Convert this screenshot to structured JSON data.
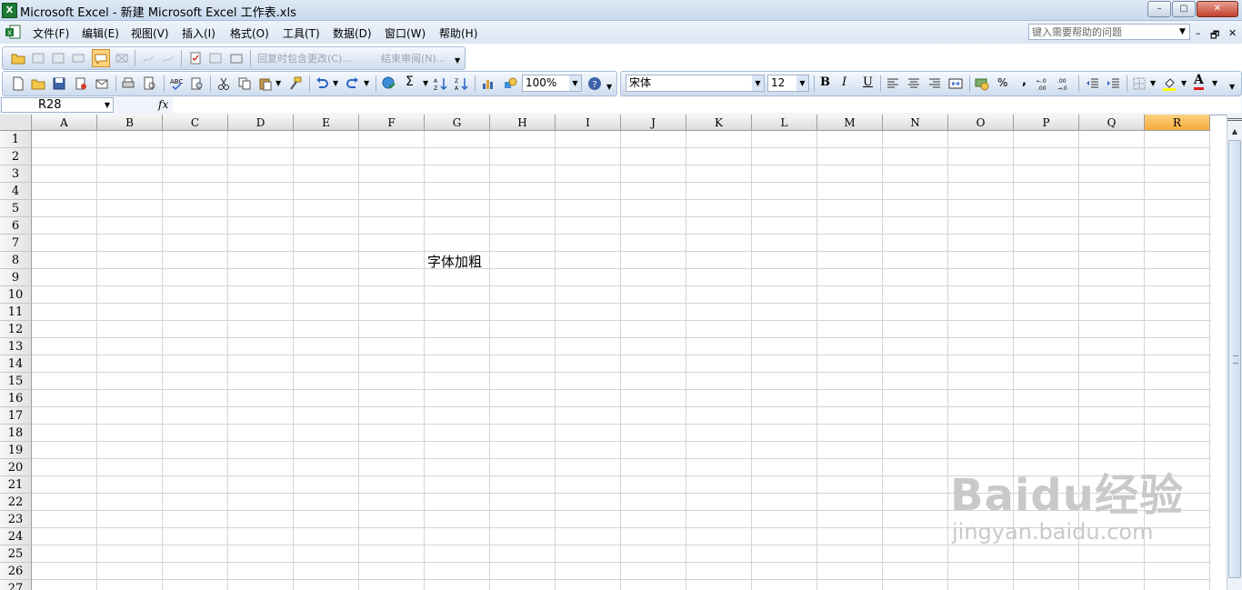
{
  "window": {
    "title": "Microsoft Excel - 新建 Microsoft Excel 工作表.xls",
    "app_icon": "X",
    "controls": {
      "minimize": "–",
      "maximize": "▢",
      "close": "✕"
    }
  },
  "menu": {
    "items": [
      "文件(F)",
      "编辑(E)",
      "视图(V)",
      "插入(I)",
      "格式(O)",
      "工具(T)",
      "数据(D)",
      "窗口(W)",
      "帮助(H)"
    ],
    "help_placeholder": "键入需要帮助的问题",
    "workbook_controls": {
      "minimize": "–",
      "restore": "🗗",
      "close": "✕"
    }
  },
  "review_toolbar": {
    "reply_label": "回复时包含更改(C)...",
    "end_review_label": "结束审阅(N)..."
  },
  "standard_toolbar": {
    "zoom": "100%",
    "sum_symbol": "Σ"
  },
  "formatting_toolbar": {
    "font": "宋体",
    "font_size": "12",
    "bold": "B",
    "italic": "I",
    "underline": "U",
    "percent": "%",
    "comma": ",",
    "font_color_letter": "A"
  },
  "formula_bar": {
    "name_box": "R28",
    "fx": "fx",
    "formula": ""
  },
  "sheet": {
    "columns": [
      "A",
      "B",
      "C",
      "D",
      "E",
      "F",
      "G",
      "H",
      "I",
      "J",
      "K",
      "L",
      "M",
      "N",
      "O",
      "P",
      "Q",
      "R"
    ],
    "active_column": "R",
    "rows": [
      "1",
      "2",
      "3",
      "4",
      "5",
      "6",
      "7",
      "8",
      "9",
      "10",
      "11",
      "12",
      "13",
      "14",
      "15",
      "16",
      "17",
      "18",
      "19",
      "20",
      "21",
      "22",
      "23",
      "24",
      "25",
      "26",
      "27"
    ],
    "cells": [
      {
        "ref": "G8",
        "value": "字体加粗"
      }
    ]
  },
  "watermark": {
    "logo": "Baidu经验",
    "url": "jingyan.baidu.com"
  },
  "colors": {
    "active_header": "#f4a93b",
    "toolbar_blue": "#cfdcee",
    "grid": "#d4d4d4"
  }
}
